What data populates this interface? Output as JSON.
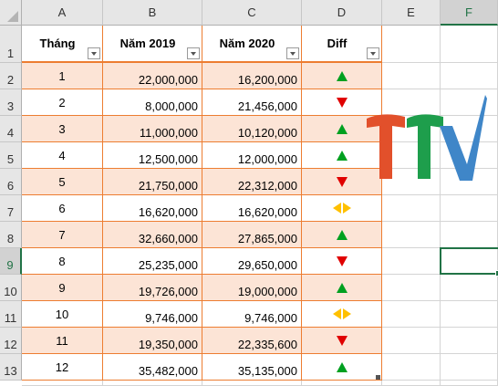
{
  "columns": [
    "A",
    "B",
    "C",
    "D",
    "E",
    "F"
  ],
  "selected_column": "F",
  "rows": [
    "1",
    "2",
    "3",
    "4",
    "5",
    "6",
    "7",
    "8",
    "9",
    "10",
    "11",
    "12",
    "13"
  ],
  "selected_row": "9",
  "table": {
    "headers": [
      "Tháng",
      "Năm 2019",
      "Năm 2020",
      "Diff"
    ],
    "data": [
      {
        "month": "1",
        "y2019": "22,000,000",
        "y2020": "16,200,000",
        "diff": "up"
      },
      {
        "month": "2",
        "y2019": "8,000,000",
        "y2020": "21,456,000",
        "diff": "down"
      },
      {
        "month": "3",
        "y2019": "11,000,000",
        "y2020": "10,120,000",
        "diff": "up"
      },
      {
        "month": "4",
        "y2019": "12,500,000",
        "y2020": "12,000,000",
        "diff": "up"
      },
      {
        "month": "5",
        "y2019": "21,750,000",
        "y2020": "22,312,000",
        "diff": "down"
      },
      {
        "month": "6",
        "y2019": "16,620,000",
        "y2020": "16,620,000",
        "diff": "equal"
      },
      {
        "month": "7",
        "y2019": "32,660,000",
        "y2020": "27,865,000",
        "diff": "up"
      },
      {
        "month": "8",
        "y2019": "25,235,000",
        "y2020": "29,650,000",
        "diff": "down"
      },
      {
        "month": "9",
        "y2019": "19,726,000",
        "y2020": "19,000,000",
        "diff": "up"
      },
      {
        "month": "10",
        "y2019": "9,746,000",
        "y2020": "9,746,000",
        "diff": "equal"
      },
      {
        "month": "11",
        "y2019": "19,350,000",
        "y2020": "22,335,600",
        "diff": "down"
      },
      {
        "month": "12",
        "y2019": "35,482,000",
        "y2020": "35,135,000",
        "diff": "up"
      }
    ]
  },
  "colors": {
    "band": "#fce4d6",
    "border": "#ed7d31",
    "up": "#00a020",
    "down": "#e00000",
    "equal": "#ffc000",
    "logo_t1": "#e2502b",
    "logo_t2": "#1e9e4c",
    "logo_v": "#3f86c8"
  },
  "icons": {
    "up": "green-up-triangle-icon",
    "down": "red-down-triangle-icon",
    "equal": "yellow-sideways-triangles-icon",
    "logo": "ttv-logo",
    "filter": "filter-dropdown-icon"
  }
}
